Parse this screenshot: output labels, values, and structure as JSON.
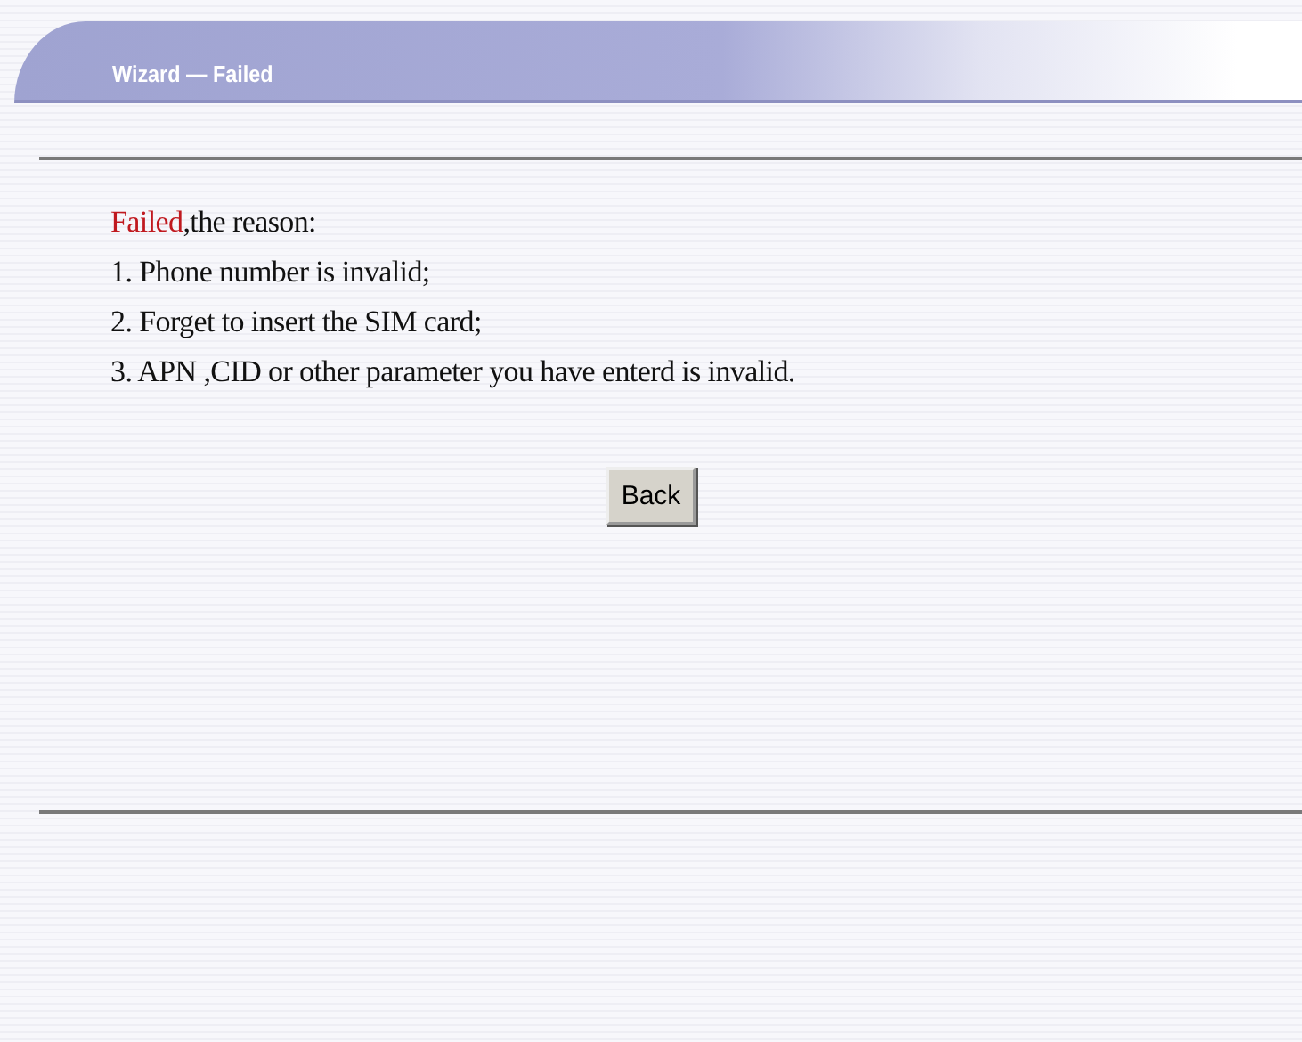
{
  "header": {
    "title": "Wizard — Failed"
  },
  "message": {
    "status": "Failed",
    "text": ",the reason:"
  },
  "reasons": [
    "1. Phone number is invalid;",
    "2. Forget to insert the SIM card;",
    "3. APN ,CID or other parameter you have enterd is invalid."
  ],
  "buttons": [
    "Back"
  ]
}
